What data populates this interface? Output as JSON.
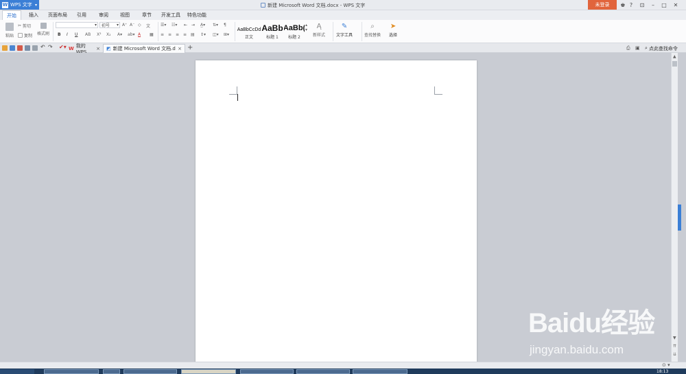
{
  "app": {
    "name": "WPS 文字",
    "doc_title": "新建 Microsoft Word 文档.docx - WPS 文字",
    "login": "未登录"
  },
  "menu": {
    "tabs": [
      "开始",
      "插入",
      "页面布局",
      "引用",
      "审阅",
      "视图",
      "章节",
      "开发工具",
      "特色功能"
    ],
    "active": "开始"
  },
  "ribbon": {
    "clipboard": {
      "paste": "粘贴",
      "cut": "剪切",
      "copy": "复制",
      "format_painter": "格式刷"
    },
    "font": {
      "size": "初号",
      "bold": "B",
      "italic": "I",
      "underline": "U",
      "strike": "AB",
      "superscript": "X²",
      "subscript": "X₂",
      "font_color": "A"
    },
    "styles": [
      {
        "sample": "AaBbCcDd",
        "label": "正文"
      },
      {
        "sample": "AaBb",
        "label": "标题 1"
      },
      {
        "sample": "AaBb(",
        "label": "标题 2"
      }
    ],
    "new_style": "新样式",
    "text_tools": "文字工具",
    "find_replace": "查找替换",
    "select": "选择"
  },
  "tabs": {
    "home": "我的WPS",
    "doc": "新建 Microsoft Word 文档.docx",
    "search_hint": "点此查找命令"
  },
  "watermark": {
    "brand": "Baidu经验",
    "url": "jingyan.baidu.com"
  },
  "taskbar": {
    "clock": "18:13"
  },
  "colors": {
    "accent": "#3b7fd6",
    "login": "#e1643c",
    "workspace": "#c9ccd3"
  }
}
